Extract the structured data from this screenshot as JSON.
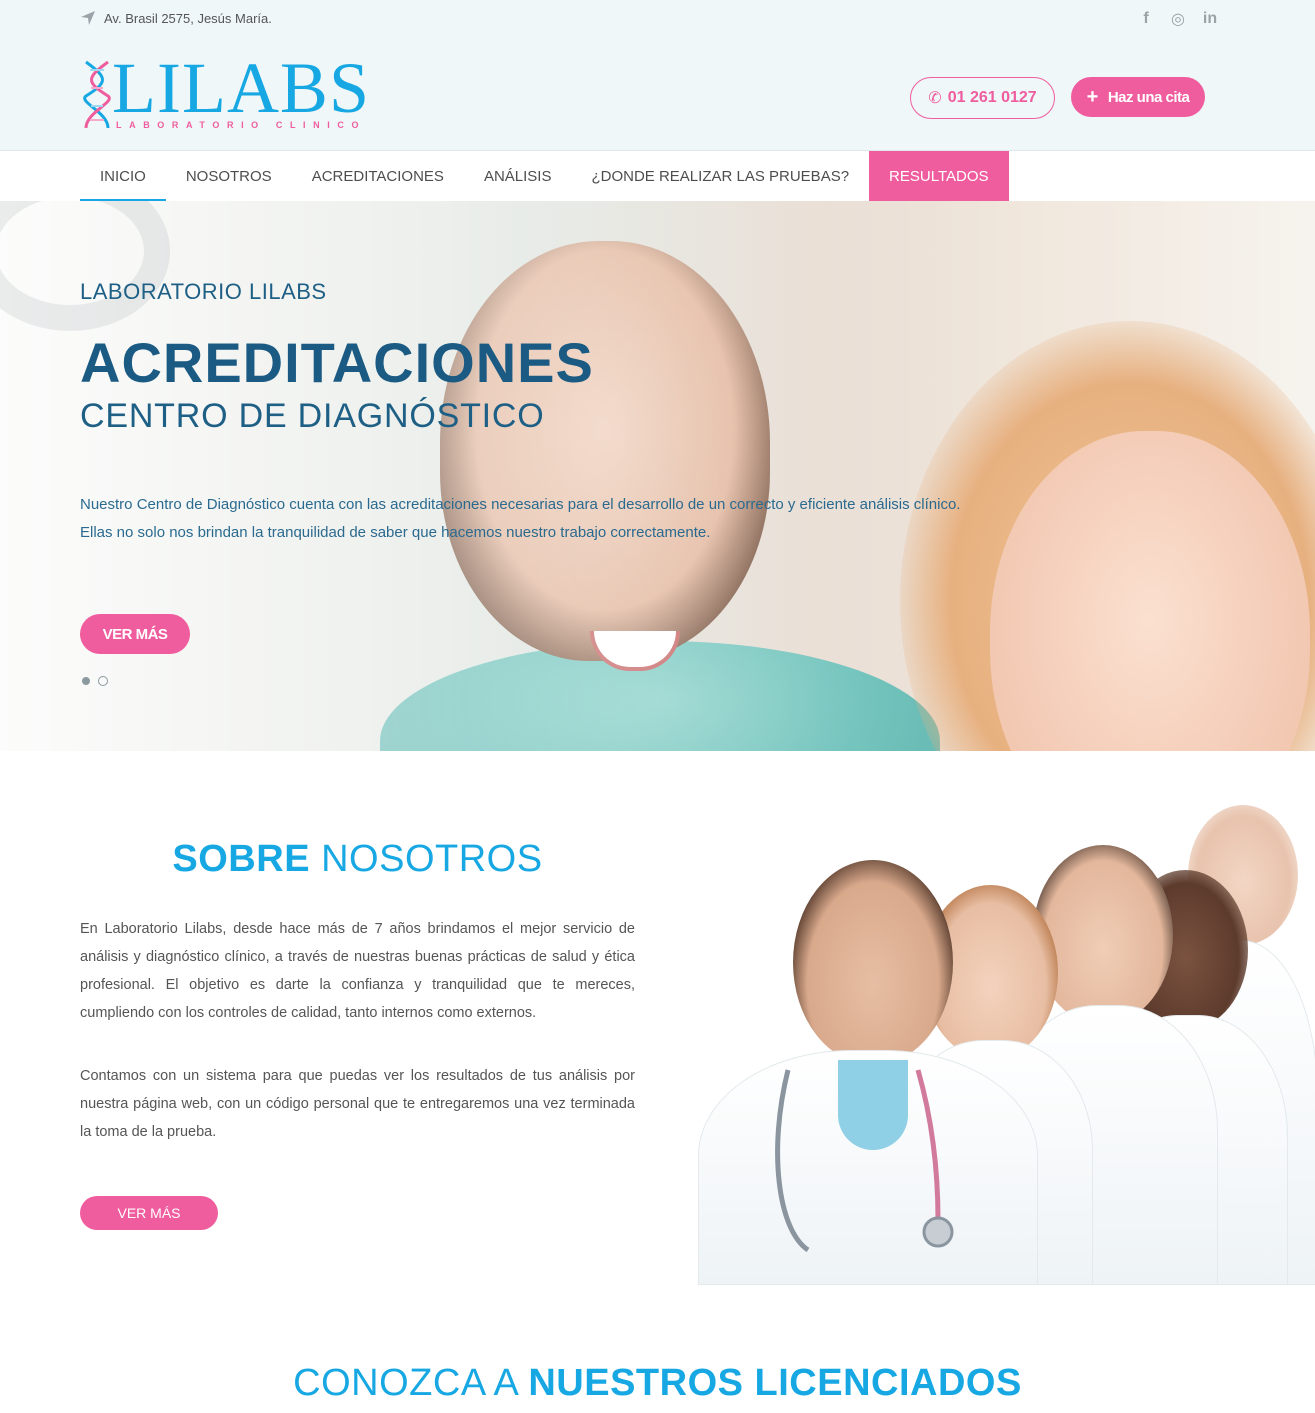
{
  "topbar": {
    "address": "Av. Brasil 2575, Jesús María.",
    "social": [
      {
        "name": "facebook",
        "glyph": "f"
      },
      {
        "name": "instagram",
        "glyph": "◎"
      },
      {
        "name": "linkedin",
        "glyph": "in"
      }
    ]
  },
  "logo": {
    "word": "LILABS",
    "tagline": "LABORATORIO CLINICO"
  },
  "header": {
    "phone": "01 261 0127",
    "appointment": "Haz una cita"
  },
  "nav": {
    "items": [
      {
        "label": "INICIO"
      },
      {
        "label": "NOSOTROS"
      },
      {
        "label": "ACREDITACIONES"
      },
      {
        "label": "ANÁLISIS"
      },
      {
        "label": "¿DONDE REALIZAR LAS PRUEBAS?"
      },
      {
        "label": "RESULTADOS"
      }
    ]
  },
  "hero": {
    "kicker": "LABORATORIO LILABS",
    "title": "ACREDITACIONES",
    "subtitle": "CENTRO DE DIAGNÓSTICO",
    "text_line1": "Nuestro Centro de Diagnóstico cuenta con las acreditaciones necesarias para el desarrollo de un correcto y eficiente análisis clínico.",
    "text_line2": "Ellas no solo nos brindan la tranquilidad de saber que hacemos nuestro trabajo correctamente.",
    "button": "VER MÁS"
  },
  "about": {
    "heading_strong": "SOBRE",
    "heading_rest": " NOSOTROS",
    "paragraph1": "En Laboratorio Lilabs, desde hace más de 7 años brindamos el mejor servicio de análisis y diagnóstico clínico, a través de nuestras buenas prácticas de salud y ética profesional. El objetivo es darte la confianza y tranquilidad que te mereces, cumpliendo con los controles de calidad, tanto internos como externos.",
    "paragraph2": "Contamos con un sistema para que puedas ver los resultados de tus análisis por nuestra página web, con un código personal que te entregaremos una vez terminada la toma de la prueba.",
    "button": "VER MÁS"
  },
  "licenciados": {
    "heading_light": "CONOZCA A ",
    "heading_strong": "NUESTROS LICENCIADOS"
  },
  "colors": {
    "brand_blue": "#17a8e3",
    "brand_pink": "#ef5d9e",
    "hero_navy": "#1b5a82"
  }
}
